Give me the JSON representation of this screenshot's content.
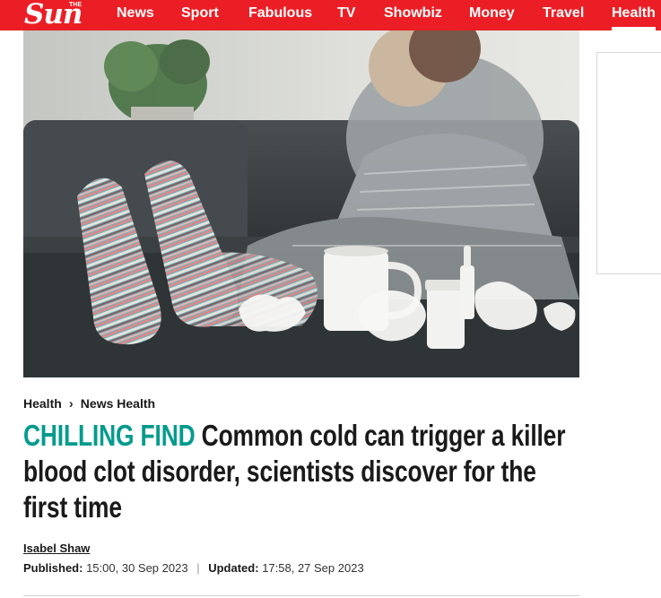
{
  "brand": {
    "logo_text": "Sun",
    "logo_small": "THE",
    "color": "#eb1e25"
  },
  "nav": {
    "items": [
      "News",
      "Sport",
      "Fabulous",
      "TV",
      "Showbiz",
      "Money",
      "Travel",
      "Health"
    ],
    "active": "Health"
  },
  "hero": {
    "icon": "photo-woman-with-cold-striped-socks"
  },
  "breadcrumb": {
    "section": "Health",
    "subsection": "News Health",
    "separator_icon": "chevron-right-icon"
  },
  "article": {
    "kicker": "CHILLING FIND",
    "kicker_color": "#009b8d",
    "headline": "Common cold can trigger a killer blood clot disorder, scientists discover for the first time",
    "author": "Isabel Shaw",
    "published_label": "Published:",
    "published_value": "15:00, 30 Sep 2023",
    "separator": "|",
    "updated_label": "Updated:",
    "updated_value": "17:58, 27 Sep 2023"
  }
}
